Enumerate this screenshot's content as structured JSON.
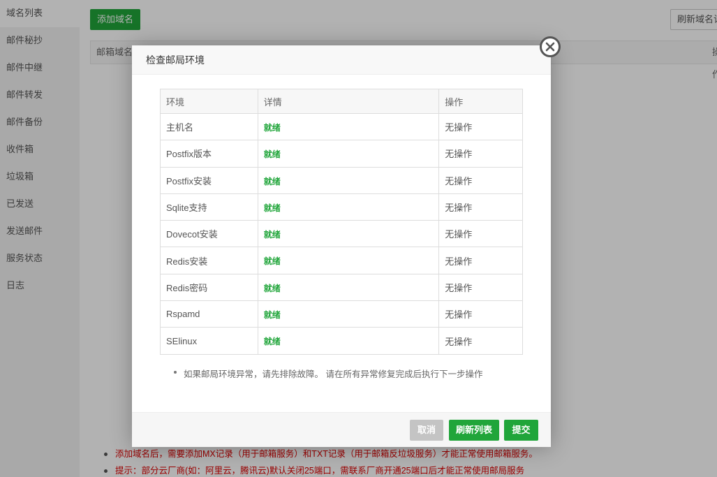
{
  "sidebar": {
    "items": [
      {
        "label": "域名列表"
      },
      {
        "label": "邮件秘抄"
      },
      {
        "label": "邮件中继"
      },
      {
        "label": "邮件转发"
      },
      {
        "label": "邮件备份"
      },
      {
        "label": "收件箱"
      },
      {
        "label": "垃圾箱"
      },
      {
        "label": "已发送"
      },
      {
        "label": "发送邮件"
      },
      {
        "label": "服务状态"
      },
      {
        "label": "日志"
      }
    ]
  },
  "toolbar": {
    "add_label": "添加域名",
    "refresh_label": "刷新域名记录"
  },
  "bg_table": {
    "col1": "邮箱域名",
    "col2": "操作"
  },
  "bg_notes": [
    "添加域名后，需要添加MX记录（用于邮箱服务）和TXT记录（用于邮箱反垃圾服务）才能正常使用邮箱服务。",
    "提示：部分云厂商(如：阿里云，腾讯云)默认关闭25端口，需联系厂商开通25端口后才能正常使用邮局服务"
  ],
  "dialog": {
    "title": "检查邮局环境",
    "headers": {
      "env": "环境",
      "detail": "详情",
      "action": "操作"
    },
    "rows": [
      {
        "env": "主机名",
        "detail": "就绪",
        "action": "无操作"
      },
      {
        "env": "Postfix版本",
        "detail": "就绪",
        "action": "无操作"
      },
      {
        "env": "Postfix安装",
        "detail": "就绪",
        "action": "无操作"
      },
      {
        "env": "Sqlite支持",
        "detail": "就绪",
        "action": "无操作"
      },
      {
        "env": "Dovecot安装",
        "detail": "就绪",
        "action": "无操作"
      },
      {
        "env": "Redis安装",
        "detail": "就绪",
        "action": "无操作"
      },
      {
        "env": "Redis密码",
        "detail": "就绪",
        "action": "无操作"
      },
      {
        "env": "Rspamd",
        "detail": "就绪",
        "action": "无操作"
      },
      {
        "env": "SElinux",
        "detail": "就绪",
        "action": "无操作"
      }
    ],
    "note": "如果邮局环境异常，请先排除故障。 请在所有异常修复完成后执行下一步操作",
    "buttons": {
      "cancel": "取消",
      "refresh": "刷新列表",
      "submit": "提交"
    }
  },
  "colors": {
    "accent": "#20a53a",
    "warning": "#dd0000",
    "disabled": "#c4c4c4"
  }
}
